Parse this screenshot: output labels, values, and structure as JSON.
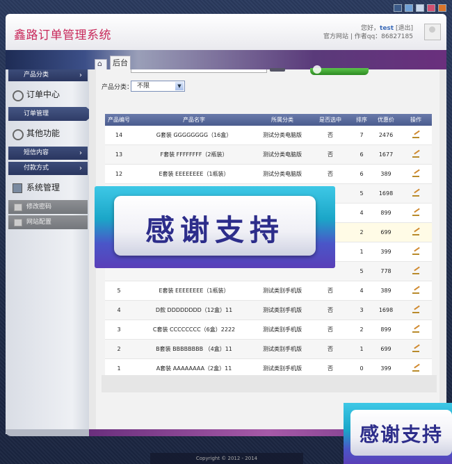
{
  "header": {
    "title": "鑫路订单管理系统",
    "greeting": "您好，",
    "username": "test",
    "logout": "[退出]",
    "official_site": "官方网站",
    "separator": "|",
    "author_qq": "作者qq：86827185"
  },
  "breadcrumb": {
    "back_tab": "后台"
  },
  "sidebar": {
    "product_category": "产品分类",
    "order_center": "订单中心",
    "order_manage": "订单管理",
    "other_functions": "其他功能",
    "sms_content": "短信内容",
    "payment_method": "付款方式",
    "system_manage": "系统管理",
    "change_password": "修改密码",
    "site_config": "网站配置",
    "arrow": "›"
  },
  "toolbar": {
    "filter_label": "产品分类：",
    "filter_value": "不限",
    "dropdown_glyph": "▼"
  },
  "table": {
    "columns": [
      "产品编号",
      "产品名字",
      "所属分类",
      "是否选中",
      "排序",
      "优惠价",
      "操作"
    ],
    "rows": [
      {
        "id": "14",
        "name": "G套装 GGGGGGGG（16盒）",
        "category": "测试分类电脑版",
        "selected": "否",
        "order": "7",
        "price": "2476"
      },
      {
        "id": "13",
        "name": "F套装 FFFFFFFF（2瓶装）",
        "category": "测试分类电脑版",
        "selected": "否",
        "order": "6",
        "price": "1677"
      },
      {
        "id": "12",
        "name": "E套装 EEEEEEEE（1瓶装）",
        "category": "测试分类电脑版",
        "selected": "否",
        "order": "6",
        "price": "389"
      },
      {
        "id": "",
        "name": "",
        "category": "",
        "selected": "",
        "order": "5",
        "price": "1698"
      },
      {
        "id": "",
        "name": "",
        "category": "",
        "selected": "",
        "order": "4",
        "price": "899"
      },
      {
        "id": "",
        "name": "",
        "category": "",
        "selected": "",
        "order": "2",
        "price": "699"
      },
      {
        "id": "",
        "name": "",
        "category": "",
        "selected": "",
        "order": "1",
        "price": "399"
      },
      {
        "id": "",
        "name": "",
        "category": "",
        "selected": "",
        "order": "5",
        "price": "778"
      },
      {
        "id": "5",
        "name": "E套装 EEEEEEEE（1瓶装）",
        "category": "测试类别手机版",
        "selected": "否",
        "order": "4",
        "price": "389"
      },
      {
        "id": "4",
        "name": "D款 DDDDDDDD（12盒）11",
        "category": "测试类别手机版",
        "selected": "否",
        "order": "3",
        "price": "1698"
      },
      {
        "id": "3",
        "name": "C套装 CCCCCCCC（6盒）2222",
        "category": "测试类别手机版",
        "selected": "否",
        "order": "2",
        "price": "899"
      },
      {
        "id": "2",
        "name": "B套装 BBBBBBBB （4盒）11",
        "category": "测试类别手机版",
        "selected": "否",
        "order": "1",
        "price": "699"
      },
      {
        "id": "1",
        "name": "A套装 AAAAAAAA（2盒）11",
        "category": "测试类别手机版",
        "selected": "否",
        "order": "0",
        "price": "399"
      }
    ]
  },
  "overlay": {
    "big_text": "感谢支持",
    "small_text": "感谢支持"
  },
  "footer": {
    "copyright": "Copyright © 2012 - 2014"
  }
}
